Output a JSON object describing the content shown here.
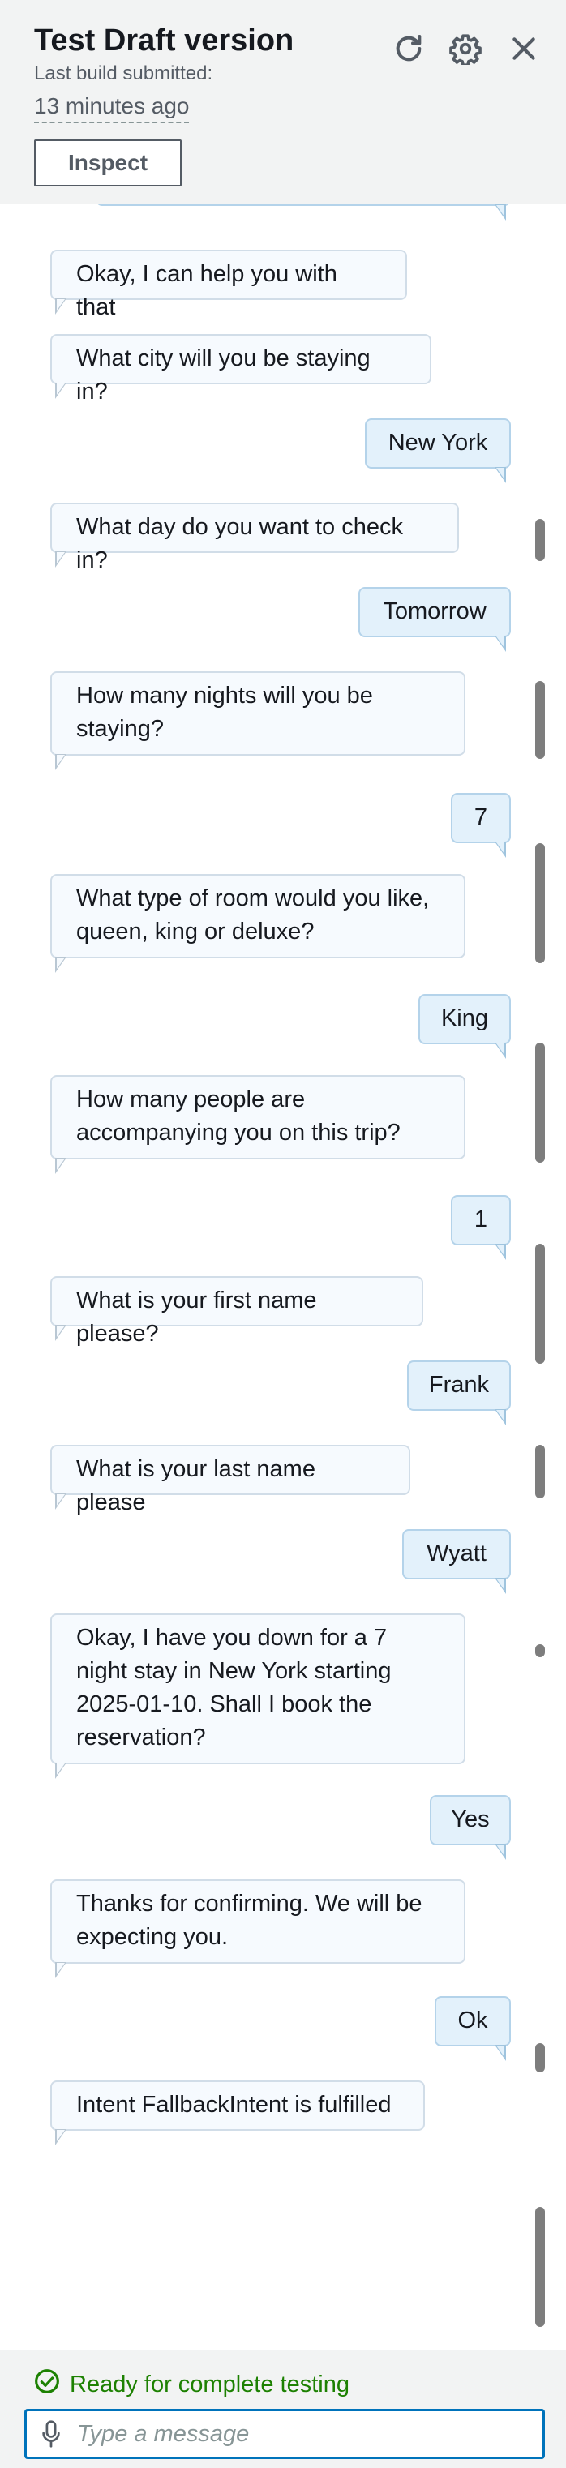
{
  "header": {
    "title": "Test Draft version",
    "subtitle": "Last build submitted:",
    "time_ago": "13 minutes ago",
    "inspect_label": "Inspect",
    "icons": [
      "refresh-icon",
      "gear-icon",
      "close-icon"
    ]
  },
  "conversation": {
    "messages": [
      {
        "role": "bot",
        "text": "Okay, I can help you with that"
      },
      {
        "role": "bot",
        "text": "What city will you be staying in?"
      },
      {
        "role": "user",
        "text": "New York"
      },
      {
        "role": "bot",
        "text": "What day do you want to check in?"
      },
      {
        "role": "user",
        "text": "Tomorrow"
      },
      {
        "role": "bot",
        "text": "How many nights will you be staying?"
      },
      {
        "role": "user",
        "text": "7"
      },
      {
        "role": "bot",
        "text": "What type of room would you like, queen, king or deluxe?"
      },
      {
        "role": "user",
        "text": "King"
      },
      {
        "role": "bot",
        "text": "How many people are accompanying you on this trip?"
      },
      {
        "role": "user",
        "text": "1"
      },
      {
        "role": "bot",
        "text": "What is your first name please?"
      },
      {
        "role": "user",
        "text": "Frank"
      },
      {
        "role": "bot",
        "text": "What is your last name please"
      },
      {
        "role": "user",
        "text": "Wyatt"
      },
      {
        "role": "bot",
        "text": "Okay, I have you down for a 7 night stay in New York starting 2025-01-10. Shall I book the reservation?"
      },
      {
        "role": "user",
        "text": "Yes"
      },
      {
        "role": "bot",
        "text": "Thanks for confirming. We will be expecting you."
      },
      {
        "role": "user",
        "text": "Ok"
      },
      {
        "role": "bot",
        "text": "Intent FallbackIntent is fulfilled"
      }
    ]
  },
  "footer": {
    "status_text": "Ready for complete testing",
    "status_color": "#1d8102",
    "input_placeholder": "Type a message",
    "input_value": ""
  },
  "colors": {
    "accent": "#0073bb",
    "bot_bubble": "#f6fafe",
    "user_bubble": "#e3f1fb",
    "header_bg": "#f2f3f3"
  }
}
